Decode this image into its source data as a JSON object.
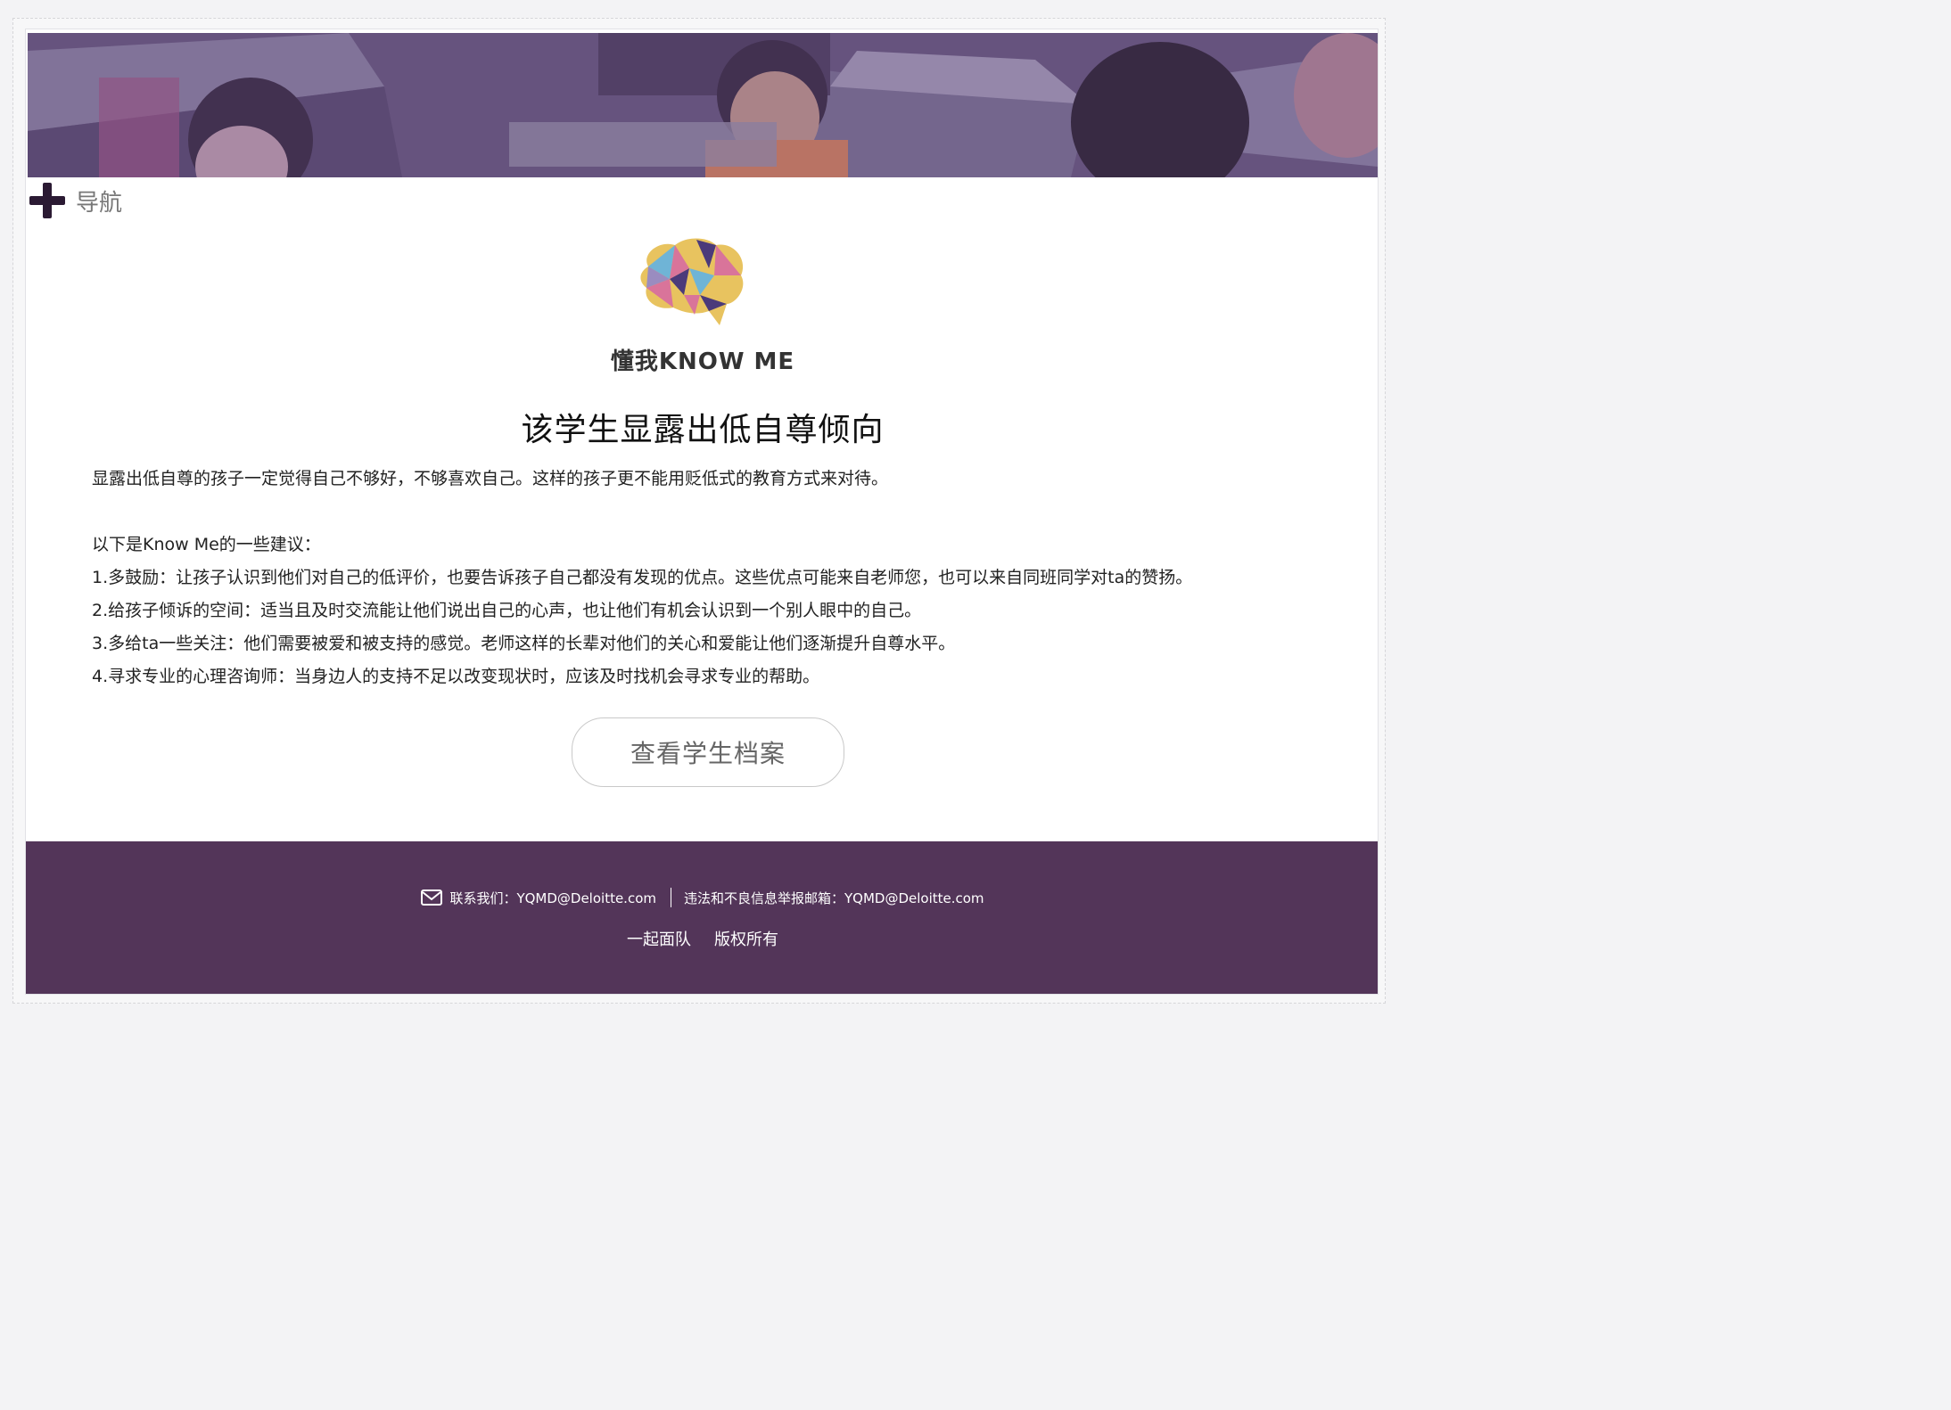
{
  "nav": {
    "label": "导航"
  },
  "logo": {
    "text": "懂我KNOW ME"
  },
  "main": {
    "title": "该学生显露出低自尊倾向",
    "intro": "显露出低自尊的孩子一定觉得自己不够好，不够喜欢自己。这样的孩子更不能用贬低式的教育方式来对待。",
    "suggestions_heading": "以下是Know Me的一些建议：",
    "suggestions": [
      "1.多鼓励：让孩子认识到他们对自己的低评价，也要告诉孩子自己都没有发现的优点。这些优点可能来自老师您，也可以来自同班同学对ta的赞扬。",
      "2.给孩子倾诉的空间：适当且及时交流能让他们说出自己的心声，也让他们有机会认识到一个别人眼中的自己。",
      "3.多给ta一些关注：他们需要被爱和被支持的感觉。老师这样的长辈对他们的关心和爱能让他们逐渐提升自尊水平。",
      "4.寻求专业的心理咨询师：当身边人的支持不足以改变现状时，应该及时找机会寻求专业的帮助。"
    ],
    "button_label": "查看学生档案"
  },
  "footer": {
    "contact": "联系我们：YQMD@Deloitte.com",
    "report": "违法和不良信息举报邮箱：YQMD@Deloitte.com",
    "links": [
      "一起面队",
      "版权所有"
    ]
  },
  "colors": {
    "footer_bg": "#533559",
    "banner_tint": "#6c5a86",
    "nav_icon": "#2b1a33"
  },
  "icons": {
    "nav": "plus-icon",
    "contact": "mail-icon",
    "logo": "brain-logo-icon"
  }
}
